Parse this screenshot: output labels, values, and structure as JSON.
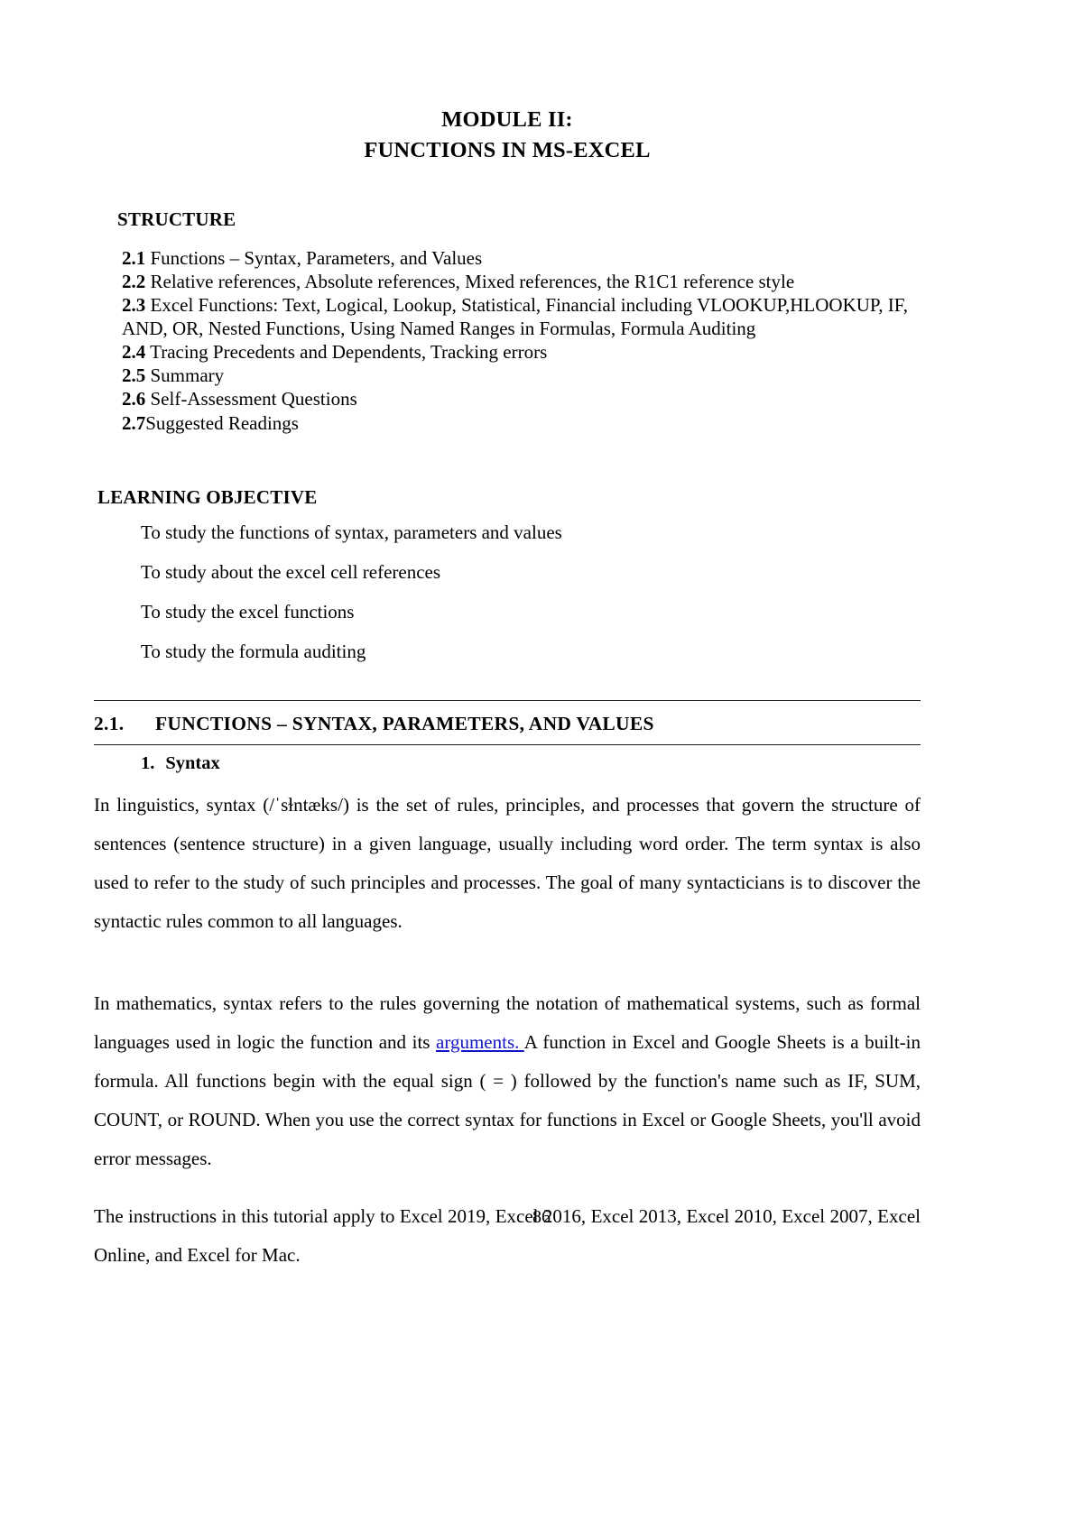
{
  "document": {
    "title_line1": "MODULE II:",
    "title_line2": "FUNCTIONS IN MS-EXCEL",
    "page_number": "86"
  },
  "structure": {
    "heading": "STRUCTURE",
    "items": [
      {
        "num": "2.1",
        "text": " Functions – Syntax, Parameters, and Values"
      },
      {
        "num": "2.2",
        "text": " Relative references, Absolute references, Mixed references, the R1C1 reference style"
      },
      {
        "num": "2.3",
        "text": " Excel Functions: Text, Logical, Lookup, Statistical, Financial including VLOOKUP,HLOOKUP, IF, AND, OR, Nested Functions, Using Named Ranges in Formulas, Formula Auditing"
      },
      {
        "num": "2.4",
        "text": " Tracing Precedents and Dependents, Tracking errors"
      },
      {
        "num": "2.5",
        "text": " Summary"
      },
      {
        "num": "2.6",
        "text": " Self-Assessment Questions"
      },
      {
        "num": "2.7",
        "text": "Suggested Readings"
      }
    ]
  },
  "learning_objective": {
    "heading": "LEARNING OBJECTIVE",
    "items": [
      "To study the functions of syntax, parameters and values",
      "To study about the excel cell references",
      "To study the excel functions",
      "To study the formula auditing"
    ]
  },
  "section": {
    "number": "2.1.",
    "title": "FUNCTIONS – SYNTAX, PARAMETERS, AND VALUES",
    "subsection": {
      "number": "1.",
      "title": "Syntax"
    },
    "paragraph1": "In linguistics, syntax (/ˈsɫntæks/) is the set of rules, principles, and processes that govern the structure of sentences (sentence structure) in a given language, usually including word order. The term syntax is also used to refer to the study of such principles and processes. The goal of many syntacticians is to discover the syntactic rules common to all languages.",
    "paragraph2_before_link": "In mathematics, syntax refers to the rules governing the notation of mathematical systems, such as formal languages used in logic the function and its ",
    "paragraph2_link": "arguments. ",
    "paragraph2_after_link": "A function in Excel and Google Sheets is a built-in formula. All functions begin with the equal sign ( = ) followed by the function's name such as IF, SUM, COUNT, or ROUND. When you use the correct syntax for functions in Excel or Google Sheets, you'll avoid error messages.",
    "paragraph3": "The instructions in this tutorial apply to Excel 2019, Excel 2016, Excel 2013, Excel 2010, Excel 2007, Excel Online, and Excel for Mac."
  },
  "colors": {
    "link": "#1414c8",
    "text": "#000000",
    "rule": "#1a1a1a"
  }
}
